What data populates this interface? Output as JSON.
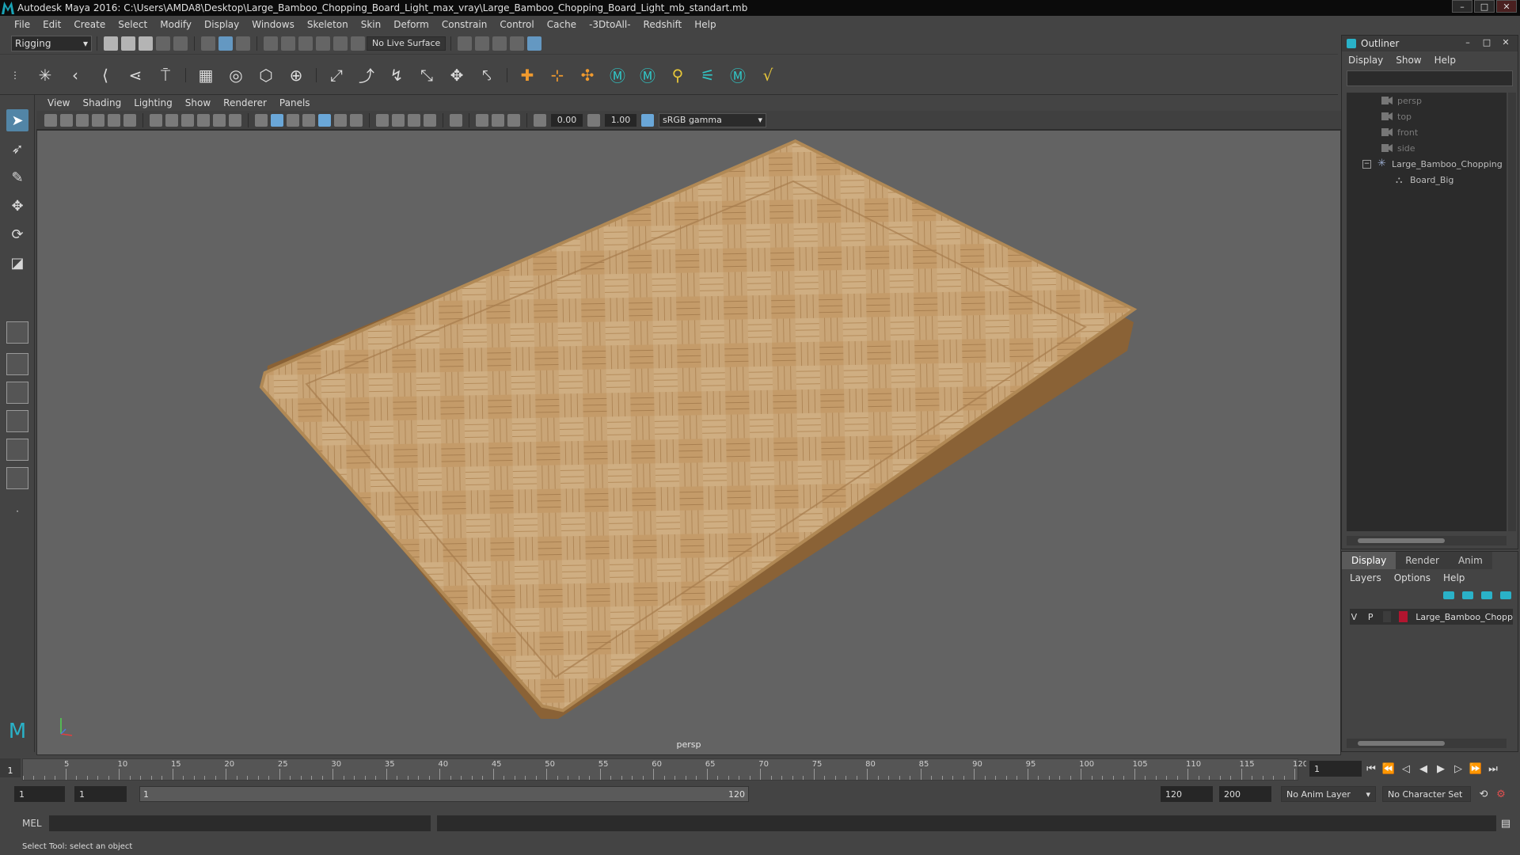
{
  "title_bar": {
    "title": "Autodesk Maya 2016: C:\\Users\\AMDA8\\Desktop\\Large_Bamboo_Chopping_Board_Light_max_vray\\Large_Bamboo_Chopping_Board_Light_mb_standart.mb",
    "minimize": "–",
    "maximize": "□",
    "close": "✕"
  },
  "menu": [
    "File",
    "Edit",
    "Create",
    "Select",
    "Modify",
    "Display",
    "Windows",
    "Skeleton",
    "Skin",
    "Deform",
    "Constrain",
    "Control",
    "Cache",
    "-3DtoAll-",
    "Redshift",
    "Help"
  ],
  "status_line": {
    "mode": "Rigging",
    "live_surface": "No Live Surface"
  },
  "panel_menu": [
    "View",
    "Shading",
    "Lighting",
    "Show",
    "Renderer",
    "Panels"
  ],
  "panel_toolbar": {
    "exposure": "0.00",
    "gamma": "1.00",
    "color_space": "sRGB gamma"
  },
  "viewport": {
    "camera_label": "persp"
  },
  "outliner": {
    "title": "Outliner",
    "menu": [
      "Display",
      "Show",
      "Help"
    ],
    "items": [
      {
        "label": "persp"
      },
      {
        "label": "top"
      },
      {
        "label": "front"
      },
      {
        "label": "side"
      },
      {
        "label": "Large_Bamboo_Chopping"
      },
      {
        "label": "Board_Big"
      }
    ]
  },
  "layer_editor": {
    "tabs": [
      "Display",
      "Render",
      "Anim"
    ],
    "menu": [
      "Layers",
      "Options",
      "Help"
    ],
    "layer": {
      "v": "V",
      "p": "P",
      "name": "Large_Bamboo_Chopp",
      "color": "#b2152f"
    }
  },
  "timeline": {
    "current_frame": "1",
    "ticks": [
      "5",
      "10",
      "15",
      "20",
      "25",
      "30",
      "35",
      "40",
      "45",
      "50",
      "55",
      "60",
      "65",
      "70",
      "75",
      "80",
      "85",
      "90",
      "95",
      "100",
      "105",
      "110",
      "115",
      "120"
    ],
    "frame_field": "1"
  },
  "range": {
    "start": "1",
    "playback_start": "1",
    "slider_start": "1",
    "slider_end": "120",
    "playback_end": "120",
    "end": "200",
    "anim_layer": "No Anim Layer",
    "character_set": "No Character Set"
  },
  "command_line": {
    "label": "MEL"
  },
  "help_line": {
    "text": "Select Tool: select an object"
  }
}
